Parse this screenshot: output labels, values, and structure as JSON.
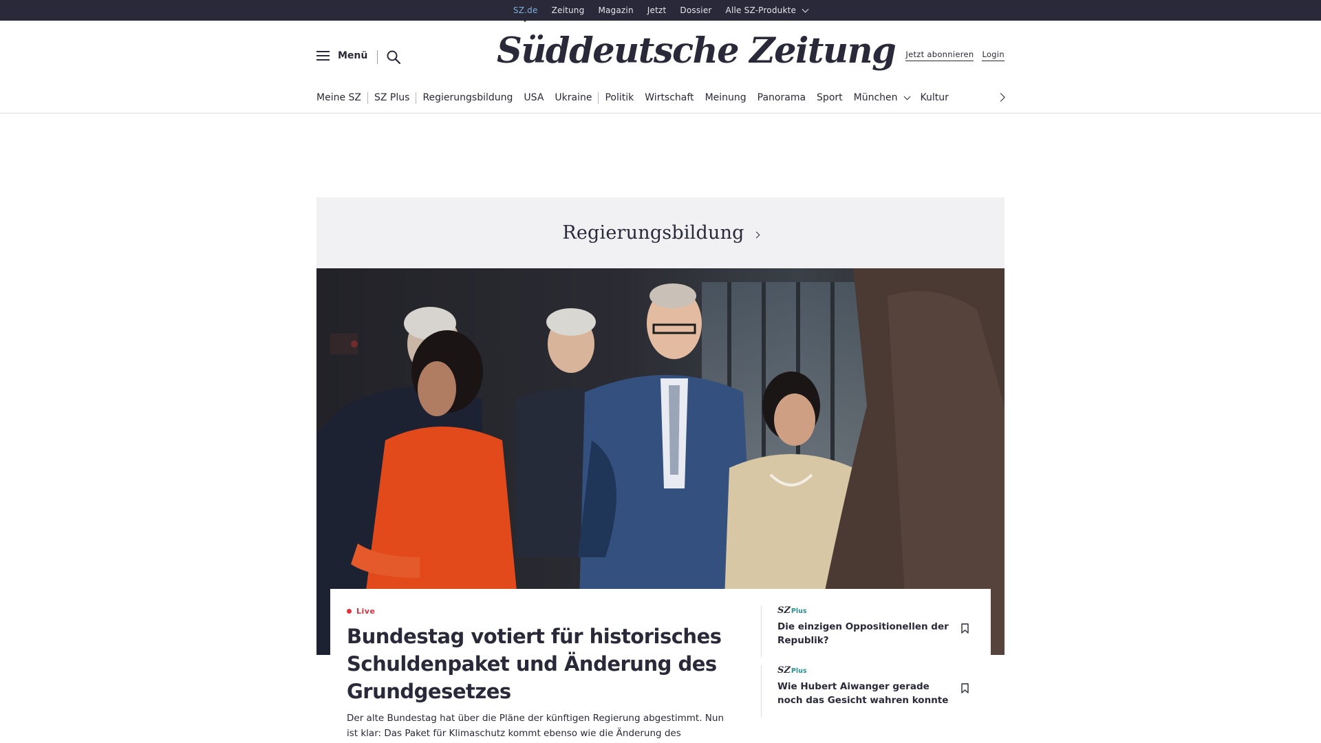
{
  "topbar": {
    "items": [
      {
        "label": "SZ.de",
        "active": true
      },
      {
        "label": "Zeitung",
        "active": false
      },
      {
        "label": "Magazin",
        "active": false
      },
      {
        "label": "Jetzt",
        "active": false
      },
      {
        "label": "Dossier",
        "active": false
      },
      {
        "label": "Alle SZ-Produkte",
        "active": false,
        "dropdown": true
      }
    ]
  },
  "header": {
    "menu_label": "Menü",
    "logo": "Süddeutsche Zeitung",
    "subscribe_label": "Jetzt abonnieren",
    "login_label": "Login"
  },
  "nav": {
    "items": [
      {
        "label": "Meine SZ"
      },
      {
        "label": "SZ Plus"
      },
      {
        "label": "Regierungsbildung"
      },
      {
        "label": "USA"
      },
      {
        "label": "Ukraine"
      },
      {
        "label": "Politik"
      },
      {
        "label": "Wirtschaft"
      },
      {
        "label": "Meinung"
      },
      {
        "label": "Panorama"
      },
      {
        "label": "Sport"
      },
      {
        "label": "München"
      },
      {
        "label": "Kultur"
      }
    ]
  },
  "topic": {
    "label": "Regierungsbildung"
  },
  "lead": {
    "live_label": "Live",
    "headline": "Bundestag votiert für historisches Schuldenpaket und Änderung des Grundgesetzes",
    "teaser": "Der alte Bundestag hat über die Pläne der künftigen Regierung abgestimmt. Nun ist klar: Das Paket für Klimaschutz kommt ebenso wie die Änderung des Grundgesetzes. Damit"
  },
  "side_articles": [
    {
      "brand": "SZ",
      "plus": "Plus",
      "title": "Die einzigen Oppositionellen der Republik?"
    },
    {
      "brand": "SZ",
      "plus": "Plus",
      "title": "Wie Hubert Aiwanger gerade noch das Gesicht wahren konnte"
    }
  ],
  "icons": {
    "menu": "hamburger-icon",
    "search": "search-icon",
    "nav_next": "chevron-right-icon",
    "bookmark": "bookmark-icon"
  },
  "colors": {
    "brand_dark": "#29293a",
    "live_red": "#d2323c",
    "plus_teal": "#2a8f8f",
    "topic_bg": "#f1f1f3"
  }
}
